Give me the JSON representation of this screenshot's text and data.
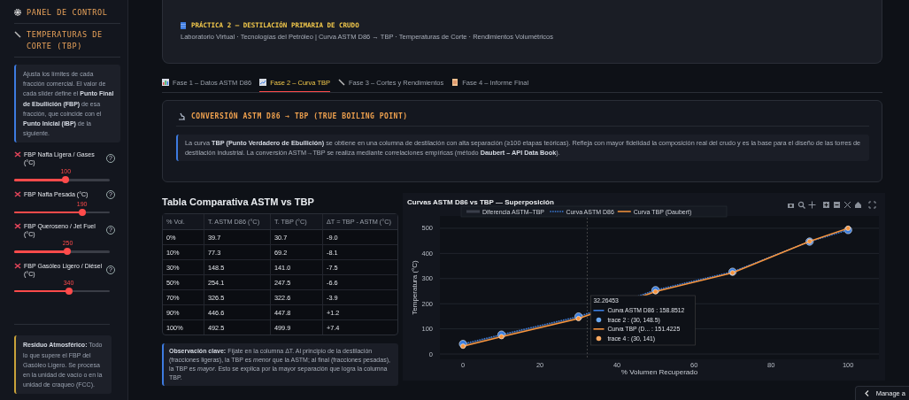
{
  "sidebar": {
    "title": "PANEL DE CONTROL",
    "section_title": "TEMPERATURAS DE CORTE (TBP)",
    "info": "Ajusta los límites de cada fracción comercial. El valor de cada slider define el **Punto Final de Ebullición (FBP)** de esa fracción, que coincide con el **Punto Inicial (IBP)** de la siguiente.",
    "sliders": [
      {
        "label": "FBP Nafta Ligera / Gases (°C)",
        "value": "100",
        "level": 0.54,
        "help": "?"
      },
      {
        "label": "FBP Nafta Pesada (°C)",
        "value": "190",
        "level": 0.71,
        "help": "?"
      },
      {
        "label": "FBP Queroseno / Jet Fuel (°C)",
        "value": "250",
        "level": 0.56,
        "help": "?"
      },
      {
        "label": "FBP Gasóleo Ligero / Diésel (°C)",
        "value": "340",
        "level": 0.57,
        "help": "?"
      }
    ],
    "note": "**Residuo Atmosférico:** Todo lo que supere el FBP del Gasóleo Ligero. Se procesa en la unidad de vacío o en la unidad de craqueo (FCC)."
  },
  "header": {
    "title": "PRÁCTICA 2 – DESTILACIÓN PRIMARIA DE CRUDO",
    "subtitle": "Laboratorio Virtual · Tecnologías del Petróleo  |  Curva ASTM D86 → TBP · Temperaturas de Corte · Rendimientos Volumétricos"
  },
  "tabs": [
    {
      "label": "Fase 1 – Datos ASTM D86",
      "kind": "bars",
      "selected": false
    },
    {
      "label": "Fase 2 – Curva TBP",
      "kind": "trend",
      "selected": true
    },
    {
      "label": "Fase 3 – Cortes y Rendimientos",
      "kind": "pen",
      "selected": false
    },
    {
      "label": "Fase 4 – Informe Final",
      "kind": "document",
      "selected": false
    }
  ],
  "conversion": {
    "title": "CONVERSIÓN ASTM D86 → TBP (TRUE BOILING POINT)",
    "text": "La curva **TBP (Punto Verdadero de Ebullición)** se obtiene en una columna de destilación con alta separación (≥100 etapas teóricas). Refleja con mayor fidelidad la composición real del crudo y es la base para el diseño de las torres de destilación industrial. La conversión ASTM→TBP se realiza mediante correlaciones empíricas (método **Daubert – API Data Book**)."
  },
  "table": {
    "title": "Tabla Comparativa ASTM vs TBP",
    "columns": [
      "% Vol.",
      "T. ASTM D86 (°C)",
      "T. TBP (°C)",
      "ΔT = TBP - ASTM (°C)"
    ],
    "rows": [
      [
        "0%",
        "39.7",
        "30.7",
        "-9.0"
      ],
      [
        "10%",
        "77.3",
        "69.2",
        "-8.1"
      ],
      [
        "30%",
        "148.5",
        "141.0",
        "-7.5"
      ],
      [
        "50%",
        "254.1",
        "247.5",
        "-6.6"
      ],
      [
        "70%",
        "326.5",
        "322.6",
        "-3.9"
      ],
      [
        "90%",
        "446.6",
        "447.8",
        "+1.2"
      ],
      [
        "100%",
        "492.5",
        "499.9",
        "+7.4"
      ]
    ]
  },
  "observation": "**Observación clave:** Fíjate en la columna ΔT. Al principio de la destilación (fracciones ligeras), la TBP es *menor* que la ASTM; al final (fracciones pesadas), la TBP es *mayor*. Esto se explica por la mayor separación que logra la columna TBP.",
  "chart": {
    "chart_data": {
      "type": "line",
      "title": "Curvas ASTM D86 vs TBP — Superposición",
      "xlabel": "% Volumen Recuperado",
      "ylabel": "Temperatura (°C)",
      "x": [
        0,
        10,
        30,
        50,
        70,
        90,
        100
      ],
      "series": [
        {
          "name": "Curva ASTM D86",
          "color": "#3b7ddd",
          "line_style": "dotted",
          "marker": "circle",
          "values": [
            40,
            77,
            149,
            254,
            327,
            447,
            493
          ]
        },
        {
          "name": "Curva TBP (Daubert)",
          "color": "#f7943d",
          "line_style": "solid",
          "marker": "circle",
          "values": [
            31,
            69,
            141,
            248,
            323,
            448,
            500
          ]
        }
      ],
      "xlim": [
        -6,
        108
      ],
      "ylim": [
        -21,
        549
      ],
      "xticks": [
        0,
        20,
        40,
        60,
        80,
        100
      ],
      "yticks": [
        0,
        100,
        200,
        300,
        400,
        500
      ],
      "grid": true,
      "legend": true,
      "ref_lines": [
        {
          "axis": "x",
          "value": 32.26
        }
      ]
    },
    "difference": {
      "name": "Diferencia ASTM–TBP",
      "color": "#3a3f4a"
    },
    "tooltip": {
      "header": "32.26453",
      "items": [
        {
          "kind": "line",
          "color": "#3b7ddd",
          "text": "Curva ASTM D86 : 158.8512"
        },
        {
          "kind": "dot",
          "color": "#6aa8f0",
          "text": "trace 2 : (30, 148.5)"
        },
        {
          "kind": "line",
          "color": "#f7943d",
          "text": "Curva TBP (D... : 151.4225"
        },
        {
          "kind": "dot",
          "color": "#f7a860",
          "text": "trace 4 : (30, 141)"
        }
      ]
    }
  },
  "manage_button": "Manage a"
}
